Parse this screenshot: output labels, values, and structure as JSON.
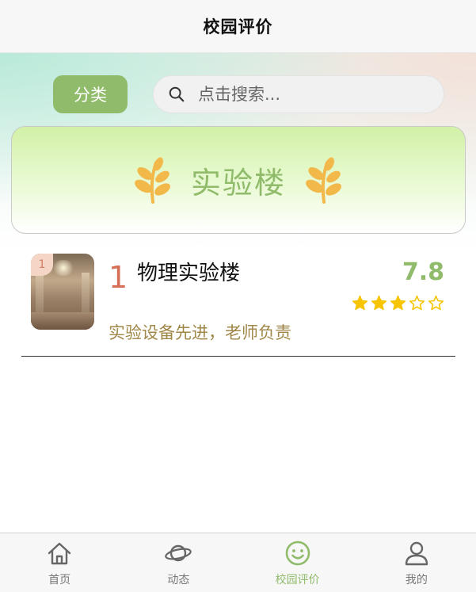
{
  "header": {
    "title": "校园评价"
  },
  "toolbar": {
    "category_label": "分类"
  },
  "search": {
    "placeholder": "点击搜索..."
  },
  "banner": {
    "title": "实验楼",
    "icon": "laurel-icon"
  },
  "list": {
    "items": [
      {
        "rank_badge": "1",
        "rank": "1",
        "name": "物理实验楼",
        "score": "7.8",
        "stars_filled": 3,
        "stars_total": 5,
        "description": "实验设备先进，老师负责"
      }
    ]
  },
  "tabbar": {
    "items": [
      {
        "label": "首页",
        "icon": "home-icon"
      },
      {
        "label": "动态",
        "icon": "planet-icon"
      },
      {
        "label": "校园评价",
        "icon": "smile-icon",
        "active": true
      },
      {
        "label": "我的",
        "icon": "user-icon"
      }
    ]
  },
  "colors": {
    "accent": "#8fbb6a",
    "rank": "#d56f57",
    "description": "#a08748",
    "star": "#f6c400"
  }
}
